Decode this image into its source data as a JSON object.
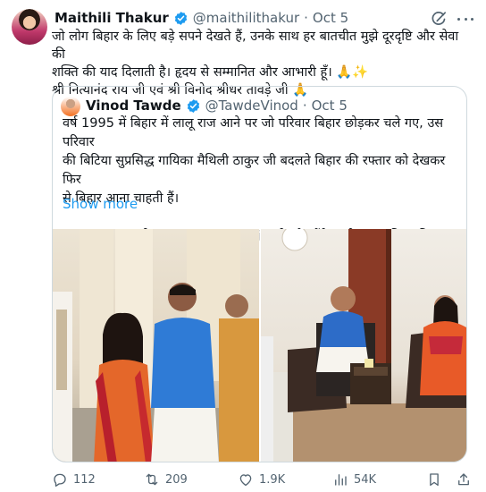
{
  "tweet": {
    "author": {
      "name": "Maithili Thakur",
      "handle": "@maithilithakur",
      "separator": "·",
      "date": "Oct 5"
    },
    "text_lines": [
      "जो लोग बिहार के लिए बड़े सपने देखते हैं, उनके साथ हर बातचीत मुझे दूरदृष्टि और सेवा की",
      "शक्ति की याद दिलाती है। हृदय से सम्मानित और आभारी हूँ। 🙏✨",
      "श्री नित्यानंद राय जी एवं श्री विनोद श्रीधर तावड़े जी 🙏"
    ],
    "quote": {
      "author": {
        "name": "Vinod Tawde",
        "handle": "@TawdeVinod",
        "separator": "·",
        "date": "Oct 5"
      },
      "text_lines": [
        "वर्ष 1995 में बिहार में लालू राज आने पर जो परिवार बिहार छोड़कर चले गए, उस परिवार",
        "की बिटिया सुप्रसिद्ध गायिका मैथिली ठाकुर जी बदलते बिहार की रफ्तार को देखकर फिर",
        "से बिहार आना चाहती हैं।",
        "आज गृह राज्यमंत्री @nityanandraibjp जी और मैंने उनसे आग्रह किया कि बिहार की..."
      ],
      "show_more": "Show more"
    },
    "actions": {
      "replies": "112",
      "reposts": "209",
      "likes": "1.9K",
      "views": "54K"
    },
    "icons": [
      "verified-badge-icon",
      "grok-icon",
      "more-icon",
      "reply-icon",
      "repost-icon",
      "like-icon",
      "views-icon",
      "bookmark-icon",
      "share-icon"
    ],
    "colors": {
      "accent": "#1d9bf0",
      "secondary_text": "#536471",
      "border": "#cfd9de"
    }
  }
}
